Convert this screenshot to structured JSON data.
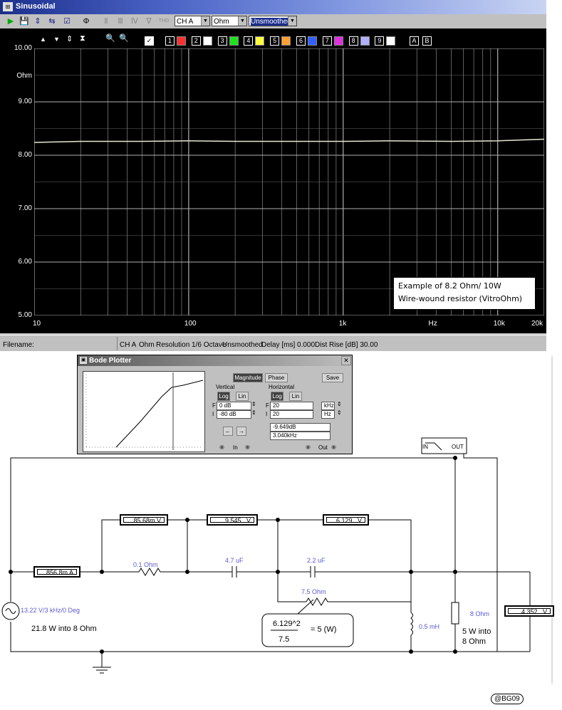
{
  "window": {
    "title": "Sinusoidal"
  },
  "toolbar": {
    "channel": "CH A",
    "unit": "Ohm",
    "smoothing": "Unsmoothed",
    "thd_label": "THD",
    "channel_checks": [
      "1",
      "2",
      "3",
      "4",
      "5",
      "6",
      "7",
      "8",
      "9"
    ],
    "channel_colors": [
      "#ff3030",
      "#ffffff",
      "#20e020",
      "#ffff40",
      "#ffa030",
      "#3060ff",
      "#e030e0",
      "#b0b0ff",
      "#ffffff"
    ],
    "letters": [
      "A",
      "B"
    ]
  },
  "plot": {
    "y_unit": "Ohm",
    "y_ticks": [
      "10.00",
      "9.00",
      "8.00",
      "7.00",
      "6.00",
      "5.00"
    ],
    "x_ticks": [
      "10",
      "100",
      "1k",
      "Hz",
      "10k",
      "20k"
    ],
    "note_line1": "Example of 8.2 Ohm/ 10W",
    "note_line2": "Wire-wound resistor (VitroOhm)"
  },
  "chart_data": {
    "type": "line",
    "xlabel": "Hz",
    "ylabel": "Ohm",
    "xscale": "log",
    "xlim": [
      10,
      20000
    ],
    "ylim": [
      5.0,
      10.0
    ],
    "grid": true,
    "series": [
      {
        "x": [
          10,
          20,
          50,
          100,
          200,
          500,
          1000,
          2000,
          5000,
          10000,
          20000
        ],
        "y": [
          8.24,
          8.26,
          8.26,
          8.27,
          8.26,
          8.26,
          8.26,
          8.27,
          8.26,
          8.27,
          8.3
        ]
      }
    ]
  },
  "status": {
    "filename": "Filename:",
    "items": [
      "CH A",
      "Ohm",
      "Resolution 1/6 Octave",
      "Unsmoothed",
      "Delay [ms] 0.000",
      "Dist Rise [dB] 30.00"
    ]
  },
  "bode": {
    "title": "Bode Plotter",
    "magnitude": "Magnitude",
    "phase": "Phase",
    "save": "Save",
    "vertical": "Vertical",
    "horizontal": "Horizontal",
    "log": "Log",
    "lin": "Lin",
    "v_f": "0 dB",
    "v_i": "-80 dB",
    "h_f": "20",
    "h_f_unit": "kHz",
    "h_i": "20",
    "h_i_unit": "Hz",
    "f_label": "F",
    "i_label": "I",
    "readout_db": "-9.649dB",
    "readout_freq": "3.040kHz",
    "in_label": "In",
    "out_label": "Out"
  },
  "circuit": {
    "bode_in": "IN",
    "bode_out": "OUT",
    "m1": "856.8m",
    "m1_unit": "A",
    "m2": "85.68m",
    "m2_unit": "V",
    "m3": "9.545",
    "m3_unit": "V",
    "m4": "6.129",
    "m4_unit": "V",
    "m5": "4.352",
    "m5_unit": "V",
    "r1": "0.1  Ohm",
    "c1": "4.7 uF",
    "c2": "2.2 uF",
    "r2": "7.5  Ohm",
    "l1": "0.5 mH",
    "r3": "8  Ohm",
    "source": "13.22 V/3 kHz/0 Deg",
    "power_in": "21.8 W into 8 Ohm",
    "formula_num": "6.129^2",
    "formula_res": "= 5 (W)",
    "formula_den": "7.5",
    "load_power_1": "5 W into",
    "load_power_2": "8 Ohm",
    "credit": "@BG09"
  }
}
